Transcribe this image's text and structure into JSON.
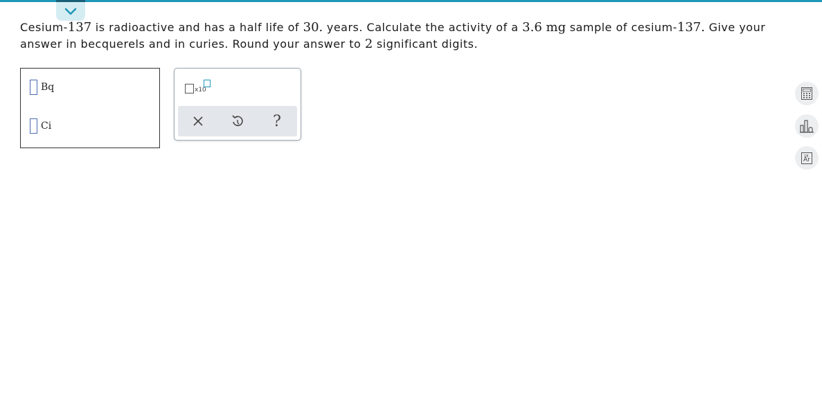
{
  "question": {
    "p1": "Cesium-",
    "n1": "137",
    "p2": " is radioactive and has a half life of ",
    "n2": "30.",
    "p3": " years. Calculate the activity of a ",
    "n3": "3.6 mg",
    "p4": " sample of cesium-",
    "n4": "137.",
    "p5": " Give your answer in becquerels and in curies. Round your answer to ",
    "n5": "2",
    "p6": " significant digits."
  },
  "answers": [
    {
      "unit": "Bq",
      "value": ""
    },
    {
      "unit": "Ci",
      "value": ""
    }
  ],
  "tools": {
    "sci_notation": "x10",
    "clear_icon": "close-icon",
    "undo_icon": "undo-icon",
    "help_icon": "help-icon",
    "help_label": "?"
  },
  "side_tools": {
    "calculator": "calculator-icon",
    "chart": "data-chart-icon",
    "periodic": "periodic-table-icon",
    "periodic_symbol": "Ar",
    "periodic_number": "18"
  },
  "colors": {
    "accent": "#1f97b8",
    "accent_dark": "#1a5f78",
    "tab_bg": "#d4edf3",
    "input_border": "#4a6bb0",
    "action_bar": "#e3e6ea"
  }
}
